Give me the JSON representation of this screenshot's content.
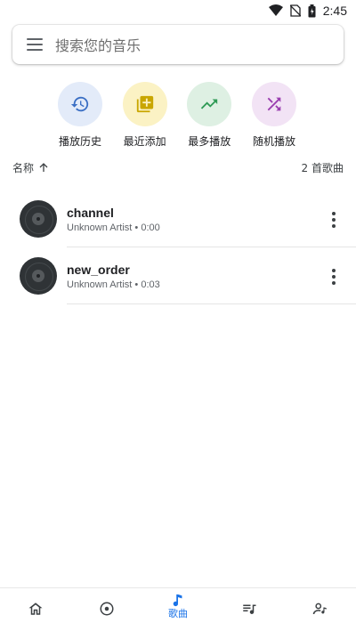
{
  "status_bar": {
    "time": "2:45"
  },
  "search": {
    "placeholder": "搜索您的音乐"
  },
  "quick_actions": [
    {
      "label": "播放历史",
      "icon": "history-icon",
      "bg": "#e3ebf9",
      "color": "#3b6fc4"
    },
    {
      "label": "最近添加",
      "icon": "library-add-icon",
      "bg": "#fbf2c4",
      "color": "#c9a600"
    },
    {
      "label": "最多播放",
      "icon": "trending-up-icon",
      "bg": "#def0e3",
      "color": "#2e9a55"
    },
    {
      "label": "随机播放",
      "icon": "shuffle-icon",
      "bg": "#f2e3f5",
      "color": "#9b3fb0"
    }
  ],
  "sort": {
    "label": "名称",
    "count": "2 首歌曲"
  },
  "songs": [
    {
      "title": "channel",
      "subtitle": "Unknown Artist • 0:00"
    },
    {
      "title": "new_order",
      "subtitle": "Unknown Artist • 0:03"
    }
  ],
  "bottom_nav": {
    "active_label": "歌曲",
    "items": [
      "home-icon",
      "album-icon",
      "music-note-icon",
      "playlist-icon",
      "artist-icon"
    ]
  },
  "colors": {
    "accent": "#1a73e8",
    "icon_gray": "#3c4043"
  }
}
